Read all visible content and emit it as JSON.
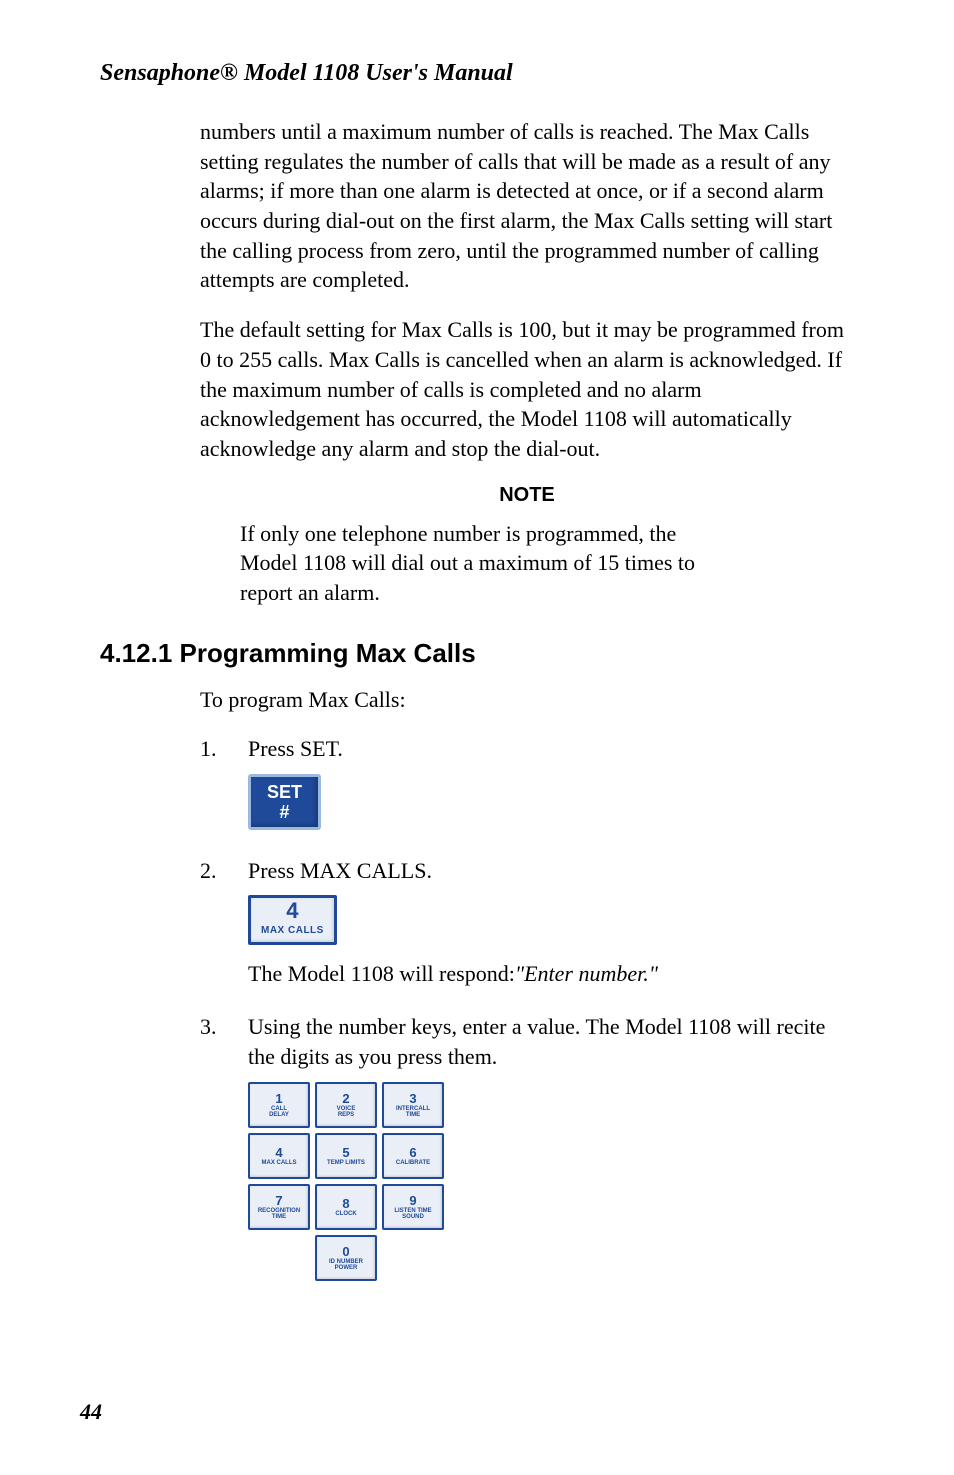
{
  "running_head": "Sensaphone® Model 1108 User's Manual",
  "para1": "numbers until a maximum number of calls is reached. The Max Calls setting regulates the number of calls that will be made as a result of any alarms; if more than one alarm is detected at once, or if a second alarm occurs during dial-out on the first alarm, the Max Calls setting will start the calling process from zero, until the programmed number of calling attempts are completed.",
  "para2": "The default setting for Max Calls is 100, but it may be programmed from 0 to 255 calls. Max Calls is cancelled when an alarm is acknowledged. If the maximum number of calls is completed and no alarm acknowledgement has occurred, the Model 1108 will automatically acknowledge any alarm and stop the dial-out.",
  "note_heading": "NOTE",
  "note_body": "If only one telephone number is programmed, the Model 1108 will dial out a maximum of 15 times to report an alarm.",
  "section_heading": "4.12.1  Programming Max Calls",
  "intro_line": "To program Max Calls:",
  "steps": {
    "s1_num": "1.",
    "s1_text": "Press SET.",
    "s2_num": "2.",
    "s2_text": "Press MAX CALLS.",
    "s2_response_prefix": "The Model 1108 will respond:",
    "s2_response_quote": "\"Enter number.\"",
    "s3_num": "3.",
    "s3_text": "Using the number keys, enter a value. The Model 1108 will recite the digits as you press them."
  },
  "buttons": {
    "set_line1": "SET",
    "set_line2": "#",
    "maxcalls_num": "4",
    "maxcalls_label": "MAX CALLS"
  },
  "keypad": {
    "k1_num": "1",
    "k1_label": "CALL\nDELAY",
    "k2_num": "2",
    "k2_label": "VOICE\nREPS",
    "k3_num": "3",
    "k3_label": "INTERCALL\nTIME",
    "k4_num": "4",
    "k4_label": "MAX CALLS",
    "k5_num": "5",
    "k5_label": "TEMP LIMITS",
    "k6_num": "6",
    "k6_label": "CALIBRATE",
    "k7_num": "7",
    "k7_label": "RECOGNITION\nTIME",
    "k8_num": "8",
    "k8_label": "CLOCK",
    "k9_num": "9",
    "k9_label": "LISTEN TIME\nSOUND",
    "k0_num": "0",
    "k0_label": "ID NUMBER\nPOWER"
  },
  "page_number": "44"
}
